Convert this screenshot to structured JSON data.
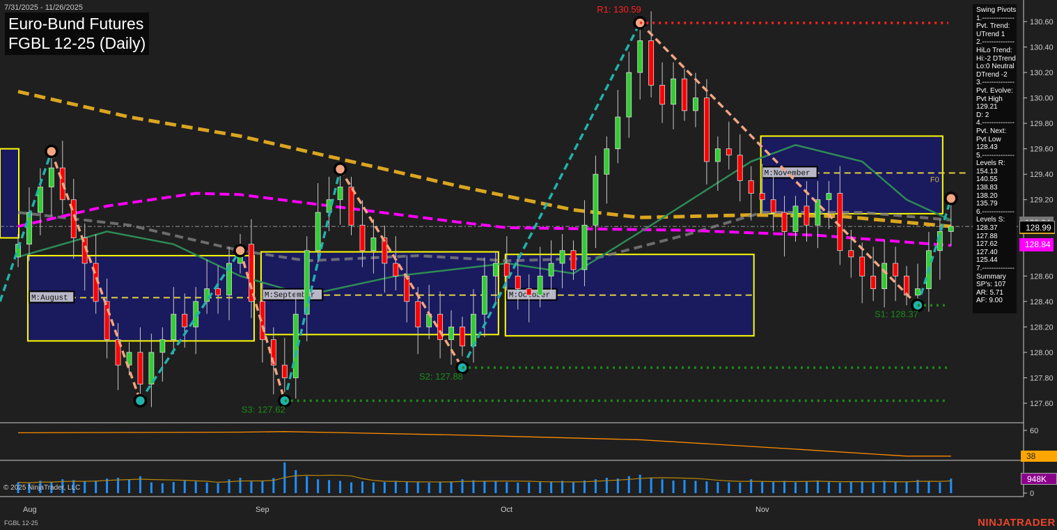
{
  "header": {
    "date_range": "7/31/2025 - 11/26/2025",
    "title_line1": "Euro-Bund Futures",
    "title_line2": "FGBL 12-25 (Daily)"
  },
  "swing_panel": {
    "lines": [
      "Swing Pivots",
      "1.--------------",
      "Pvt. Trend:",
      "UTrend 1",
      "2.--------------",
      "HiLo Trend:",
      "Hi:-2 DTrend",
      "Lo:0 Neutral",
      "DTrend -2",
      "3.--------------",
      "Pvt. Evolve:",
      "Pvt High",
      "129.21",
      "D: 2",
      "4.--------------",
      "Pvt. Next:",
      "Pvt Low",
      "128.43",
      "5.--------------",
      "Levels R:",
      "154.13",
      "140.55",
      "138.83",
      "138.20",
      "135.79",
      "6.--------------",
      "Levels S:",
      "128.37",
      "127.88",
      "127.62",
      "127.40",
      "125.44",
      "7.--------------",
      "Summary",
      "SP's: 107",
      "AR: 5.71",
      "AF: 9.00"
    ]
  },
  "price_labels": {
    "gray": "129.04",
    "last": "128.99",
    "magenta": "128.84",
    "osc": "38",
    "volume": "948K"
  },
  "footer": {
    "copyright": "© 2025 NinjaTrader, LLC",
    "instrument": "FGBL 12-25",
    "logo": "NINJATRADER"
  },
  "colors": {
    "up": "#32cd32",
    "down": "#ff0000",
    "box": "#1a1a5e",
    "box_border": "#ffff00",
    "ma_gold": "#daa520",
    "ma_magenta": "#ff00ff",
    "ma_gray": "#808080",
    "ma_green": "#2e8b57",
    "leg_up": "#20b2aa",
    "leg_down": "#f4a582",
    "volume": "#1e90ff",
    "osc": "#ff8c00"
  },
  "chart_data": {
    "type": "candlestick",
    "title": "Euro-Bund Futures FGBL 12-25 (Daily)",
    "y_ticks": [
      "130.60",
      "130.40",
      "130.20",
      "130.00",
      "129.80",
      "129.60",
      "129.40",
      "129.20",
      "128.60",
      "128.40",
      "128.20",
      "128.00",
      "127.80",
      "127.60"
    ],
    "y_range": [
      127.5,
      130.7
    ],
    "x_labels": [
      {
        "label": "Aug",
        "day": 1
      },
      {
        "label": "Sep",
        "day": 22
      },
      {
        "label": "Oct",
        "day": 44
      },
      {
        "label": "Nov",
        "day": 67
      }
    ],
    "closes": [
      128.85,
      129.1,
      129.3,
      129.45,
      129.2,
      128.9,
      128.7,
      128.4,
      128.1,
      127.9,
      128.0,
      127.75,
      128.0,
      128.1,
      128.3,
      128.2,
      128.4,
      128.5,
      128.45,
      128.7,
      128.85,
      128.4,
      128.1,
      127.9,
      127.8,
      128.3,
      128.8,
      129.1,
      129.2,
      129.3,
      129.0,
      128.8,
      128.9,
      128.7,
      128.6,
      128.4,
      128.2,
      128.3,
      128.1,
      128.2,
      128.05,
      128.3,
      128.6,
      128.7,
      128.6,
      128.5,
      128.45,
      128.6,
      128.7,
      128.8,
      128.65,
      129.0,
      129.4,
      129.6,
      129.85,
      130.2,
      130.45,
      130.1,
      129.95,
      130.15,
      129.9,
      130.0,
      129.5,
      129.6,
      129.55,
      129.35,
      129.25,
      129.2,
      129.1,
      128.95,
      129.15,
      129.0,
      129.2,
      129.25,
      128.8,
      128.75,
      128.6,
      128.5,
      128.7,
      128.6,
      128.45,
      128.5,
      128.8,
      128.95,
      128.99
    ],
    "volume_k": [
      700,
      650,
      800,
      720,
      900,
      850,
      760,
      820,
      950,
      1000,
      880,
      1100,
      700,
      640,
      720,
      800,
      760,
      690,
      650,
      900,
      1000,
      760,
      820,
      980,
      2000,
      1500,
      1100,
      900,
      850,
      800,
      700,
      760,
      690,
      720,
      800,
      760,
      700,
      680,
      720,
      760,
      900,
      840,
      800,
      760,
      720,
      690,
      700,
      720,
      760,
      800,
      700,
      820,
      900,
      1000,
      950,
      1100,
      1200,
      1000,
      900,
      820,
      860,
      800,
      760,
      720,
      700,
      680,
      900,
      760,
      720,
      800,
      700,
      760,
      820,
      720,
      680,
      740,
      780,
      700,
      800,
      760,
      720,
      860,
      780,
      700,
      948
    ],
    "pivots": [
      {
        "day": 3,
        "price": 129.58
      },
      {
        "day": 11,
        "price": 127.62
      },
      {
        "day": 20,
        "price": 128.8
      },
      {
        "day": 24,
        "price": 127.62
      },
      {
        "day": 29,
        "price": 129.44
      },
      {
        "day": 40,
        "price": 127.88
      },
      {
        "day": 56,
        "price": 130.59
      },
      {
        "day": 81,
        "price": 128.37
      },
      {
        "day": 84,
        "price": 129.21
      }
    ],
    "levels": [
      {
        "name": "R1",
        "label": "R1: 130.59",
        "price": 130.59,
        "from_day": 56,
        "color": "#ff2020"
      },
      {
        "name": "S1",
        "label": "S1: 128.37",
        "price": 128.37,
        "from_day": 81,
        "color": "#1a8a1a"
      },
      {
        "name": "S2",
        "label": "S2: 127.88",
        "price": 127.88,
        "from_day": 40,
        "color": "#1a8a1a"
      },
      {
        "name": "S3",
        "label": "S3: 127.62",
        "price": 127.62,
        "from_day": 24,
        "color": "#1a8a1a"
      }
    ],
    "month_boxes": [
      {
        "label": "M:August",
        "from_day": 1,
        "to_day": 21,
        "high": 128.76,
        "low": 128.09,
        "mid": 128.43
      },
      {
        "label": "M:September",
        "from_day": 22,
        "to_day": 43,
        "high": 128.79,
        "low": 128.14,
        "mid": 128.45
      },
      {
        "label": "M:October",
        "from_day": 44,
        "to_day": 66,
        "high": 128.77,
        "low": 128.13,
        "mid": 128.45
      },
      {
        "label": "M:November",
        "from_day": 67,
        "to_day": 83,
        "high": 129.7,
        "low": 129.09,
        "mid": 129.41,
        "tag": "F0"
      }
    ],
    "ma_gold": [
      [
        0,
        130.05
      ],
      [
        10,
        129.85
      ],
      [
        20,
        129.7
      ],
      [
        30,
        129.5
      ],
      [
        40,
        129.3
      ],
      [
        50,
        129.12
      ],
      [
        56,
        129.06
      ],
      [
        66,
        129.08
      ],
      [
        74,
        129.07
      ],
      [
        84,
        128.99
      ]
    ],
    "ma_magenta": [
      [
        0,
        128.99
      ],
      [
        8,
        129.15
      ],
      [
        16,
        129.25
      ],
      [
        20,
        129.24
      ],
      [
        30,
        129.13
      ],
      [
        40,
        129.02
      ],
      [
        44,
        128.98
      ],
      [
        60,
        128.96
      ],
      [
        72,
        128.92
      ],
      [
        84,
        128.84
      ]
    ],
    "ma_gray": [
      [
        0,
        129.1
      ],
      [
        10,
        129.0
      ],
      [
        20,
        128.8
      ],
      [
        26,
        128.72
      ],
      [
        36,
        128.76
      ],
      [
        44,
        128.72
      ],
      [
        52,
        128.74
      ],
      [
        60,
        128.92
      ],
      [
        67,
        129.1
      ],
      [
        76,
        129.1
      ],
      [
        84,
        129.04
      ]
    ],
    "ma_green": [
      [
        0,
        128.75
      ],
      [
        8,
        128.95
      ],
      [
        14,
        128.85
      ],
      [
        20,
        128.6
      ],
      [
        26,
        128.45
      ],
      [
        34,
        128.6
      ],
      [
        44,
        128.7
      ],
      [
        50,
        128.62
      ],
      [
        57,
        129.0
      ],
      [
        66,
        129.5
      ],
      [
        70,
        129.63
      ],
      [
        76,
        129.5
      ],
      [
        80,
        129.2
      ],
      [
        84,
        129.04
      ]
    ],
    "oscillator": {
      "tick": "60",
      "values": [
        [
          0,
          58
        ],
        [
          20,
          58.5
        ],
        [
          24,
          59
        ],
        [
          40,
          56
        ],
        [
          56,
          52
        ],
        [
          70,
          44
        ],
        [
          80,
          38
        ],
        [
          84,
          38
        ]
      ]
    }
  }
}
